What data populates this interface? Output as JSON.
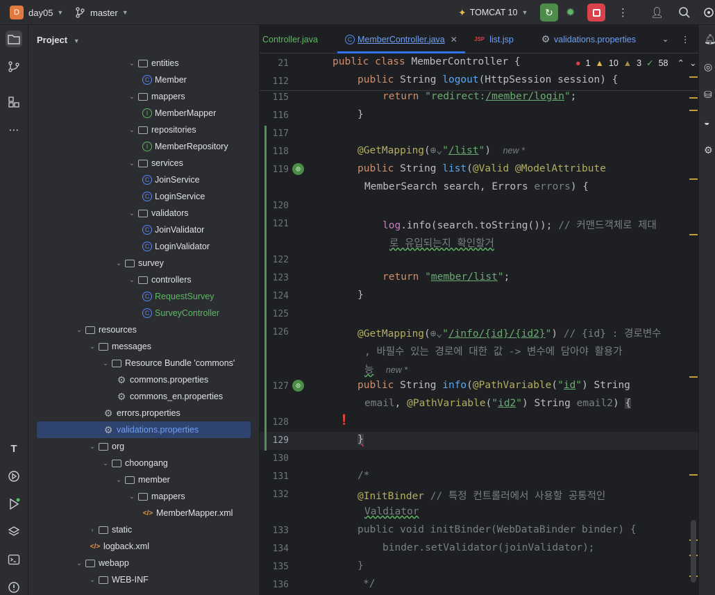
{
  "topbar": {
    "project_badge": "D",
    "project_name": "day05",
    "branch": "master",
    "run_config": "TOMCAT 10"
  },
  "panel": {
    "title": "Project"
  },
  "tree": [
    {
      "label": "entities",
      "type": "folder",
      "depth": 7,
      "expanded": true
    },
    {
      "label": "Member",
      "type": "class",
      "depth": 8
    },
    {
      "label": "mappers",
      "type": "folder",
      "depth": 7,
      "expanded": true
    },
    {
      "label": "MemberMapper",
      "type": "interface",
      "depth": 8
    },
    {
      "label": "repositories",
      "type": "folder",
      "depth": 7,
      "expanded": true
    },
    {
      "label": "MemberRepository",
      "type": "interface",
      "depth": 8
    },
    {
      "label": "services",
      "type": "folder",
      "depth": 7,
      "expanded": true
    },
    {
      "label": "JoinService",
      "type": "class",
      "depth": 8
    },
    {
      "label": "LoginService",
      "type": "class",
      "depth": 8
    },
    {
      "label": "validators",
      "type": "folder",
      "depth": 7,
      "expanded": true
    },
    {
      "label": "JoinValidator",
      "type": "class",
      "depth": 8
    },
    {
      "label": "LoginValidator",
      "type": "class",
      "depth": 8
    },
    {
      "label": "survey",
      "type": "folder",
      "depth": 6,
      "expanded": true
    },
    {
      "label": "controllers",
      "type": "folder",
      "depth": 7,
      "expanded": true
    },
    {
      "label": "RequestSurvey",
      "type": "class",
      "depth": 8,
      "vcs": "added"
    },
    {
      "label": "SurveyController",
      "type": "class",
      "depth": 8,
      "vcs": "added"
    },
    {
      "label": "resources",
      "type": "folder",
      "depth": 3,
      "expanded": true
    },
    {
      "label": "messages",
      "type": "folder",
      "depth": 4,
      "expanded": true
    },
    {
      "label": "Resource Bundle 'commons'",
      "type": "bundle",
      "depth": 5,
      "expanded": true
    },
    {
      "label": "commons.properties",
      "type": "props",
      "depth": 6
    },
    {
      "label": "commons_en.properties",
      "type": "props",
      "depth": 6
    },
    {
      "label": "errors.properties",
      "type": "props",
      "depth": 5
    },
    {
      "label": "validations.properties",
      "type": "props",
      "depth": 5,
      "selected": true
    },
    {
      "label": "org",
      "type": "folder",
      "depth": 4,
      "expanded": true
    },
    {
      "label": "choongang",
      "type": "folder",
      "depth": 5,
      "expanded": true
    },
    {
      "label": "member",
      "type": "folder",
      "depth": 6,
      "expanded": true
    },
    {
      "label": "mappers",
      "type": "folder",
      "depth": 7,
      "expanded": true
    },
    {
      "label": "MemberMapper.xml",
      "type": "xml",
      "depth": 8
    },
    {
      "label": "static",
      "type": "folder",
      "depth": 4,
      "expanded": false
    },
    {
      "label": "logback.xml",
      "type": "xml",
      "depth": 4
    },
    {
      "label": "webapp",
      "type": "folder",
      "depth": 3,
      "expanded": true
    },
    {
      "label": "WEB-INF",
      "type": "folder",
      "depth": 4,
      "expanded": true
    }
  ],
  "tabs": [
    {
      "label": "Controller.java",
      "icon": "",
      "active": false
    },
    {
      "label": "MemberController.java",
      "icon": "class-icon",
      "active": true
    },
    {
      "label": "list.jsp",
      "icon": "jsp-icon",
      "active": false
    },
    {
      "label": "validations.properties",
      "icon": "gear-icon",
      "active": false
    }
  ],
  "inspections": {
    "errors": "1",
    "warnings": "10",
    "weak": "3",
    "typos": "58"
  },
  "editor": {
    "sticky": [
      {
        "ln": "21",
        "text": "public class MemberController {"
      },
      {
        "ln": "112",
        "text": "public String logout(HttpSession session) {"
      }
    ],
    "lines": {
      "l115": "115",
      "l116": "116",
      "l117": "117",
      "l118": "118",
      "l119": "119",
      "l120": "120",
      "l121": "121",
      "l122": "122",
      "l123": "123",
      "l124": "124",
      "l125": "125",
      "l126": "126",
      "l127": "127",
      "l128": "128",
      "l129": "129",
      "l130": "130",
      "l131": "131",
      "l132": "132",
      "l133": "133",
      "l134": "134",
      "l135": "135",
      "l136": "136"
    },
    "hint_new": "new *",
    "comment_121": "// 커맨드객체로 제대",
    "comment_121b": "로 유입되는지 확인할거",
    "comment_126": "// {id} : 경로변수",
    "comment_126b": ", 바필수 있는 경로에 대한 값 -> 변수에 담아야 활용가",
    "comment_126c": "능",
    "comment_132": "// 특정 컨트롤러에서 사용할 공통적인",
    "comment_132b": "Valdiator"
  }
}
